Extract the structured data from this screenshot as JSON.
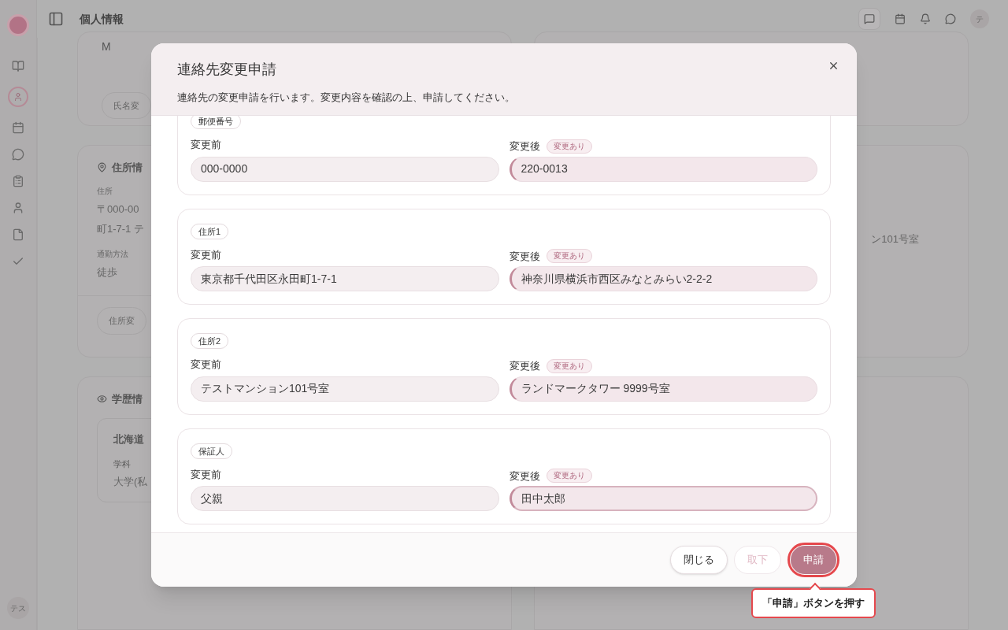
{
  "header": {
    "title": "個人情報",
    "avatar": "テ"
  },
  "sidebar": {
    "avatar": "テス"
  },
  "background": {
    "name_card": {
      "value": "M",
      "button": "氏名変"
    },
    "address_card": {
      "title": "住所情",
      "address_label": "住所",
      "address_lines": [
        "〒000-00",
        "町1-7-1 テ"
      ],
      "commute_label": "通勤方法",
      "commute_value": "徒歩",
      "button": "住所変"
    },
    "education_card": {
      "title": "学歴情",
      "school": "北海道",
      "dept_label": "学科",
      "dept_value": "大学(私"
    },
    "right_address_tail": "ン101号室"
  },
  "dialog": {
    "title": "連絡先変更申請",
    "description": "連絡先の変更申請を行います。変更内容を確認の上、申請してください。",
    "items": [
      {
        "label": "郵便番号",
        "before_label": "変更前",
        "before": "000-0000",
        "after_label": "変更後",
        "badge": "変更あり",
        "changed": true,
        "after": "220-0013",
        "focused": false
      },
      {
        "label": "住所1",
        "before_label": "変更前",
        "before": "東京都千代田区永田町1-7-1",
        "after_label": "変更後",
        "badge": "変更あり",
        "changed": true,
        "after": "神奈川県横浜市西区みなとみらい2-2-2",
        "focused": false
      },
      {
        "label": "住所2",
        "before_label": "変更前",
        "before": "テストマンション101号室",
        "after_label": "変更後",
        "badge": "変更あり",
        "changed": true,
        "after": "ランドマークタワー 9999号室",
        "focused": false
      },
      {
        "label": "保証人",
        "before_label": "変更前",
        "before": "父親",
        "after_label": "変更後",
        "badge": "変更あり",
        "changed": true,
        "after": "田中太郎",
        "focused": true
      }
    ],
    "buttons": [
      {
        "label": "閉じる",
        "kind": "secondary",
        "disabled": false,
        "highlighted": false
      },
      {
        "label": "取下",
        "kind": "secondary",
        "disabled": true,
        "highlighted": false
      },
      {
        "label": "申請",
        "kind": "primary",
        "disabled": false,
        "highlighted": true
      }
    ]
  },
  "callout": {
    "text": "「申請」ボタンを押す"
  }
}
